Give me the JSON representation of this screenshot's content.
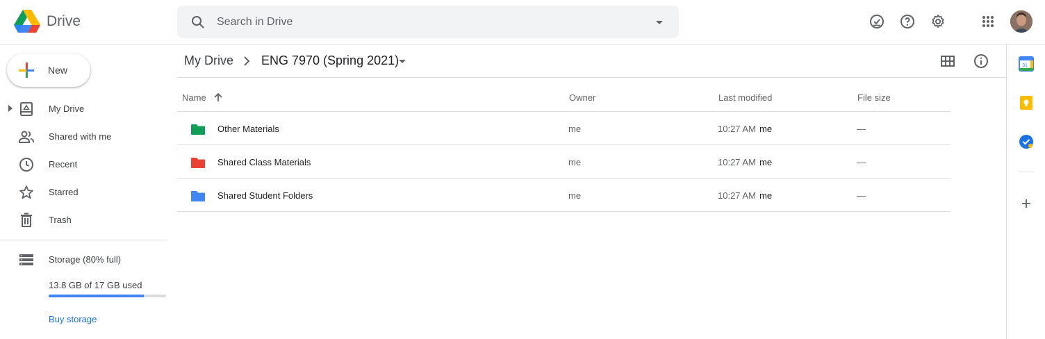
{
  "app": {
    "name": "Drive"
  },
  "search": {
    "placeholder": "Search in Drive"
  },
  "header_icons": [
    "ready-for-offline-icon",
    "help-icon",
    "settings-icon",
    "apps-grid-icon"
  ],
  "nav": {
    "new_label": "New",
    "items": [
      {
        "label": "My Drive",
        "icon": "my-drive-icon"
      },
      {
        "label": "Shared with me",
        "icon": "people-icon"
      },
      {
        "label": "Recent",
        "icon": "clock-icon"
      },
      {
        "label": "Starred",
        "icon": "star-icon"
      },
      {
        "label": "Trash",
        "icon": "trash-icon"
      }
    ],
    "storage": {
      "label": "Storage (80% full)",
      "usage_text": "13.8 GB of 17 GB used",
      "fraction": 0.81,
      "buy_label": "Buy storage"
    }
  },
  "breadcrumb": {
    "root": "My Drive",
    "current": "ENG 7970 (Spring 2021)"
  },
  "table": {
    "columns": {
      "name": "Name",
      "owner": "Owner",
      "modified": "Last modified",
      "size": "File size"
    },
    "rows": [
      {
        "name": "Other Materials",
        "owner": "me",
        "modified": "10:27 AM",
        "modified_by": "me",
        "size": "—",
        "color": "#0f9d58"
      },
      {
        "name": "Shared Class Materials",
        "owner": "me",
        "modified": "10:27 AM",
        "modified_by": "me",
        "size": "—",
        "color": "#ea4335"
      },
      {
        "name": "Shared Student Folders",
        "owner": "me",
        "modified": "10:27 AM",
        "modified_by": "me",
        "size": "—",
        "color": "#4285f4"
      }
    ]
  },
  "side_panel": [
    "calendar-icon",
    "keep-icon",
    "tasks-icon",
    "add-addon-icon"
  ],
  "colors": {
    "accent": "#1a73e8",
    "divider": "#dadce0",
    "storage_bar": "#4285f4"
  }
}
